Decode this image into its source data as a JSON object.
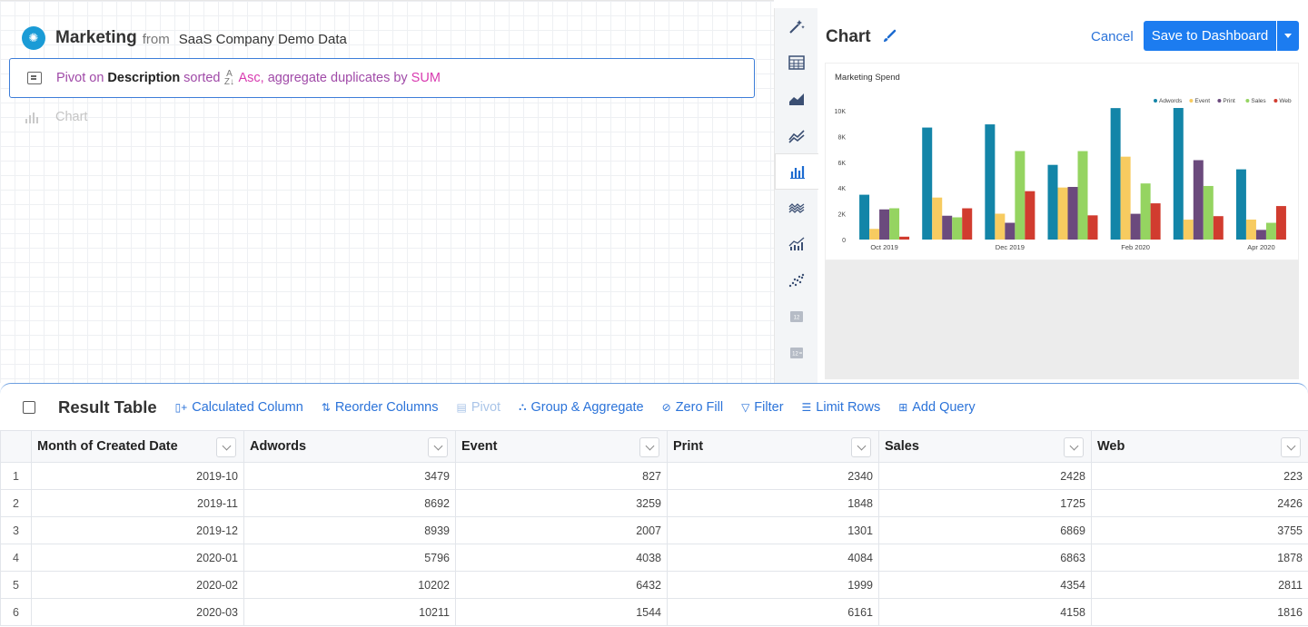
{
  "pipeline": {
    "source_title": "Marketing",
    "from_label": "from",
    "source_name": "SaaS Company Demo Data",
    "step": {
      "prefix": "Pivot on",
      "field": "Description",
      "sorted_label": "sorted",
      "sort_dir": "Asc,",
      "aggregate_label": "aggregate duplicates by",
      "aggregate_fn": "SUM"
    },
    "chart_step_label": "Chart"
  },
  "toolbar": {
    "items": [
      "magic-wand-icon",
      "table-icon",
      "area-chart-icon",
      "line-chart-icon",
      "bar-chart-icon",
      "stream-chart-icon",
      "combo-chart-icon",
      "scatter-chart-icon",
      "single-value-icon",
      "value-change-icon"
    ],
    "active": "bar-chart-icon"
  },
  "chart_panel": {
    "title": "Chart",
    "cancel_label": "Cancel",
    "save_label": "Save to Dashboard"
  },
  "chart_data": {
    "type": "bar",
    "title": "Marketing Spend",
    "categories": [
      "2019-10",
      "2019-11",
      "2019-12",
      "2020-01",
      "2020-02",
      "2020-03",
      "2020-04"
    ],
    "x_tick_labels": [
      "Oct 2019",
      "Dec 2019",
      "Feb 2020",
      "Apr 2020"
    ],
    "x_tick_category_index": [
      0,
      2,
      4,
      6
    ],
    "y_ticks": [
      "0",
      "2K",
      "4K",
      "6K",
      "8K",
      "10K"
    ],
    "ylim": [
      0,
      10000
    ],
    "legend_position": "top-right",
    "series": [
      {
        "name": "Adwords",
        "color": "#1385a8",
        "values": [
          3479,
          8692,
          8939,
          5796,
          10202,
          10211,
          5450
        ]
      },
      {
        "name": "Event",
        "color": "#f7cb60",
        "values": [
          827,
          3259,
          2007,
          4038,
          6432,
          1544,
          1550
        ]
      },
      {
        "name": "Print",
        "color": "#6b4a7d",
        "values": [
          2340,
          1848,
          1301,
          4084,
          1999,
          6161,
          750
        ]
      },
      {
        "name": "Sales",
        "color": "#95d461",
        "values": [
          2428,
          1725,
          6869,
          6863,
          4354,
          4158,
          1300
        ]
      },
      {
        "name": "Web",
        "color": "#d13c2f",
        "values": [
          223,
          2426,
          3755,
          1878,
          2811,
          1816,
          2600
        ]
      }
    ]
  },
  "result_table": {
    "title": "Result Table",
    "actions": [
      {
        "label": "Calculated Column",
        "icon": "calculated-column-icon",
        "enabled": true
      },
      {
        "label": "Reorder Columns",
        "icon": "reorder-columns-icon",
        "enabled": true
      },
      {
        "label": "Pivot",
        "icon": "pivot-icon",
        "enabled": false
      },
      {
        "label": "Group & Aggregate",
        "icon": "group-aggregate-icon",
        "enabled": true
      },
      {
        "label": "Zero Fill",
        "icon": "zero-fill-icon",
        "enabled": true
      },
      {
        "label": "Filter",
        "icon": "filter-icon",
        "enabled": true
      },
      {
        "label": "Limit Rows",
        "icon": "limit-rows-icon",
        "enabled": true
      },
      {
        "label": "Add Query",
        "icon": "add-query-icon",
        "enabled": true
      }
    ],
    "columns": [
      "Month of Created Date",
      "Adwords",
      "Event",
      "Print",
      "Sales",
      "Web"
    ],
    "rows": [
      [
        "1",
        "2019-10",
        "3479",
        "827",
        "2340",
        "2428",
        "223"
      ],
      [
        "2",
        "2019-11",
        "8692",
        "3259",
        "1848",
        "1725",
        "2426"
      ],
      [
        "3",
        "2019-12",
        "8939",
        "2007",
        "1301",
        "6869",
        "3755"
      ],
      [
        "4",
        "2020-01",
        "5796",
        "4038",
        "4084",
        "6863",
        "1878"
      ],
      [
        "5",
        "2020-02",
        "10202",
        "6432",
        "1999",
        "4354",
        "2811"
      ],
      [
        "6",
        "2020-03",
        "10211",
        "1544",
        "6161",
        "4158",
        "1816"
      ]
    ]
  }
}
